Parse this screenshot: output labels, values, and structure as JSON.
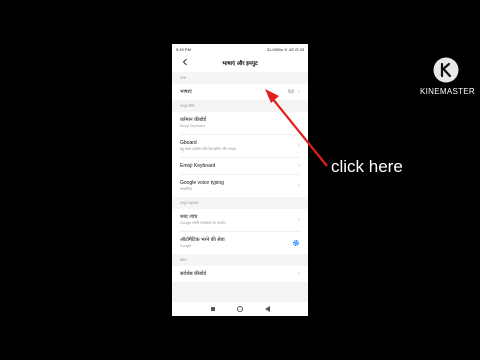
{
  "status": {
    "time": "5:19 PM",
    "right": "31.0KB/s ⊙ 4G ⊟ 33"
  },
  "header": {
    "title": "भाषाएं और इनपुट",
    "back_icon": "arrow-left-icon"
  },
  "sections": {
    "language": {
      "header": "भाषा",
      "row_title": "भाषाएं",
      "row_value": "हिंदी"
    },
    "keyboards": {
      "header": "इनपुट विधि",
      "rows": [
        {
          "title": "वर्तमान कीबोर्ड",
          "sub": "Emoji Keyboard"
        },
        {
          "title": "Gboard",
          "sub": "बहु-भाषा टाइपिंग और हैंडराइटिंग और ग्लाइड"
        },
        {
          "title": "Emoji Keyboard",
          "sub": ""
        },
        {
          "title": "Google voice typing",
          "sub": "स्वचालित"
        }
      ]
    },
    "input_assist": {
      "header": "इनपुट सहायता",
      "rows": [
        {
          "title": "शब्द जांच",
          "sub": "Google वर्तनी जांचकर्ता का उपयोग"
        },
        {
          "title": "ऑटोमैटिक भरने की सेवा",
          "sub": "Google"
        }
      ]
    },
    "more": {
      "header": "संबंध",
      "row_title": "सर्वश्रेष्ठ कीबोर्ड"
    }
  },
  "annotation": {
    "text": "click here",
    "arrow_color": "#e02020"
  },
  "watermark": {
    "brand": "KINEMASTER",
    "logo_icon": "kinemaster-logo-icon"
  },
  "colors": {
    "accent": "#0d84ff",
    "background": "#000000"
  }
}
